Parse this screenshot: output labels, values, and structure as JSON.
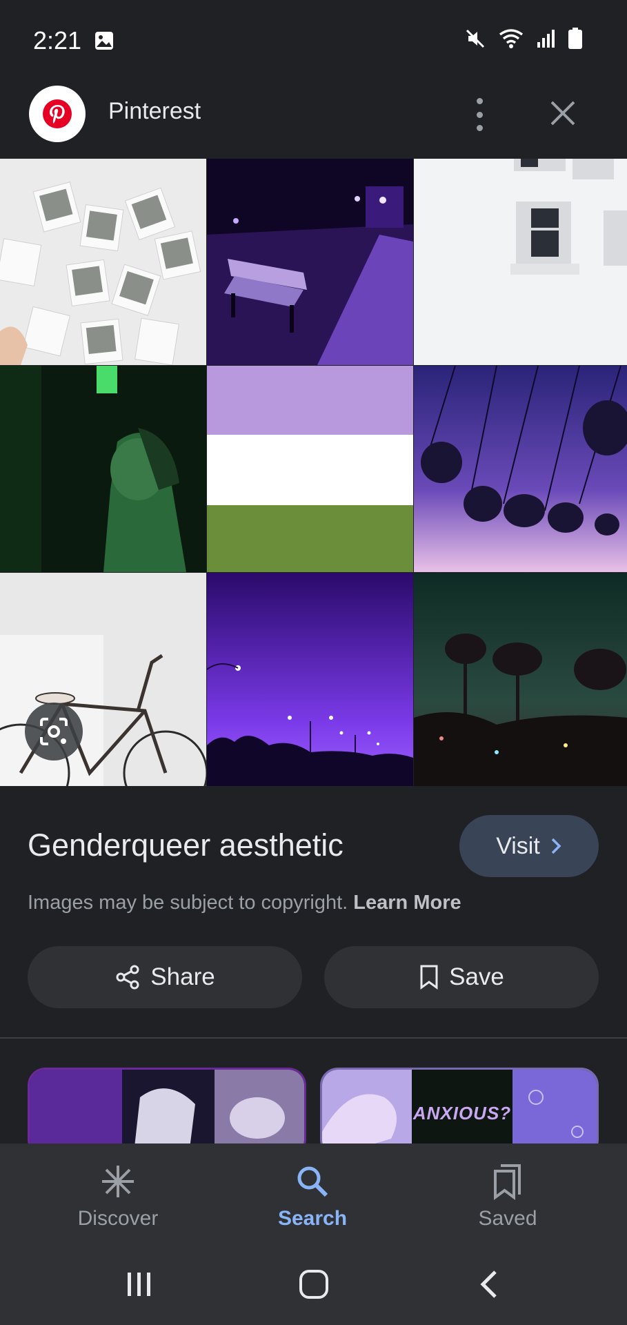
{
  "status_bar": {
    "time": "2:21",
    "left_icons": [
      "image-icon"
    ],
    "right_icons": [
      "mute-icon",
      "wifi-icon",
      "signal-icon",
      "battery-icon"
    ]
  },
  "header": {
    "source_name": "Pinterest",
    "logo_icon": "pinterest-logo",
    "brand_color": "#e60023"
  },
  "image_grid": {
    "tiles": [
      "polaroids-collage",
      "purple-park-bench",
      "white-building-window",
      "green-couple",
      "genderqueer-flag",
      "purple-swing-ride",
      "white-bicycle",
      "purple-streetlights",
      "green-palm-trees"
    ]
  },
  "result": {
    "title": "Genderqueer aesthetic",
    "visit_label": "Visit",
    "copyright_text": "Images may be subject to copyright.",
    "learn_more": "Learn More",
    "share_label": "Share",
    "save_label": "Save"
  },
  "related": {
    "card_2_text": "ANXIOUS?"
  },
  "bottom_nav": {
    "items": [
      {
        "label": "Discover",
        "icon": "asterisk-icon"
      },
      {
        "label": "Search",
        "icon": "search-icon",
        "active": true
      },
      {
        "label": "Saved",
        "icon": "bookmarks-icon"
      }
    ],
    "active_color": "#8ab4f8"
  },
  "system_nav": [
    "recents-icon",
    "home-icon",
    "back-icon"
  ]
}
